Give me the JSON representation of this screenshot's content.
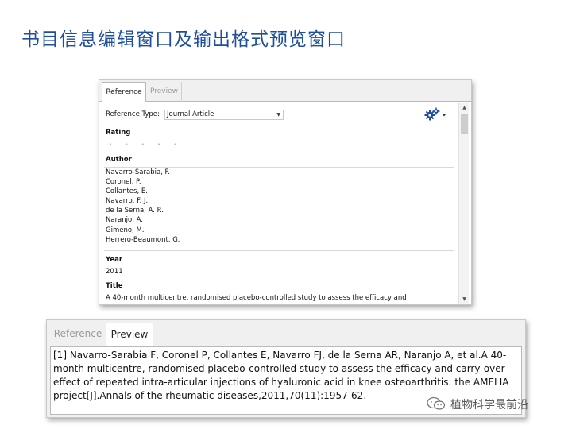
{
  "slide": {
    "title": "书目信息编辑窗口及输出格式预览窗口"
  },
  "reference_panel": {
    "tabs": [
      "Reference",
      "Preview"
    ],
    "reference_type_label": "Reference Type:",
    "reference_type_value": "Journal Article",
    "rating_label": "Rating",
    "rating_stars": "• • • • •",
    "author_label": "Author",
    "authors": [
      "Navarro-Sarabia, F.",
      "Coronel, P.",
      "Collantes, E.",
      "Navarro, F. J.",
      "de la Serna, A. R.",
      "Naranjo, A.",
      "Gimeno, M.",
      "Herrero-Beaumont, G."
    ],
    "year_label": "Year",
    "year_value": "2011",
    "title_label": "Title",
    "title_value": "A 40-month multicentre, randomised placebo-controlled study to assess the efficacy and",
    "icons": {
      "settings": "gear-icon",
      "dropdown": "chevron-down-icon"
    }
  },
  "preview_panel": {
    "tabs": [
      "Reference",
      "Preview"
    ],
    "citation": "[1] Navarro-Sarabia F, Coronel P, Collantes E, Navarro FJ, de la Serna AR, Naranjo A, et al.A 40-month multicentre, randomised placebo-controlled study to assess the efficacy and carry-over effect of repeated intra-articular injections of hyaluronic acid in knee osteoarthritis: the AMELIA project[J].Annals of the rheumatic diseases,2011,70(11):1957-62."
  },
  "watermark": {
    "text": "植物科学最前沿"
  },
  "colors": {
    "title": "#1f4e9c",
    "gear": "#1f4e9c"
  }
}
